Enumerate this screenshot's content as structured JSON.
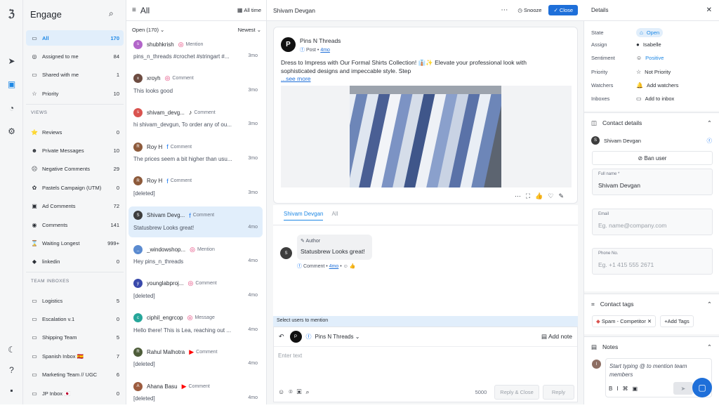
{
  "app": {
    "title": "Engage"
  },
  "sidebar": {
    "items": [
      {
        "icon": "inbox-icon",
        "glyph": "▭",
        "label": "All",
        "count": "170",
        "selected": true
      },
      {
        "icon": "user-icon",
        "glyph": "◎",
        "label": "Assigned to me",
        "count": "84"
      },
      {
        "icon": "share-icon",
        "glyph": "▭",
        "label": "Shared with me",
        "count": "1"
      },
      {
        "icon": "star-icon",
        "glyph": "☆",
        "label": "Priority",
        "count": "10"
      }
    ],
    "views_heading": "VIEWS",
    "views": [
      {
        "icon": "star-emoji-icon",
        "glyph": "⭐",
        "label": "Reviews",
        "count": "0"
      },
      {
        "icon": "face-emoji-icon",
        "glyph": "☻",
        "label": "Private Messages",
        "count": "10"
      },
      {
        "icon": "angry-emoji-icon",
        "glyph": "☹",
        "label": "Negative Comments",
        "count": "29"
      },
      {
        "icon": "leaf-emoji-icon",
        "glyph": "✿",
        "label": "Pastels Campaign (UTM)",
        "count": "0"
      },
      {
        "icon": "ad-emoji-icon",
        "glyph": "▣",
        "label": "Ad Comments",
        "count": "72"
      },
      {
        "icon": "target-emoji-icon",
        "glyph": "◉",
        "label": "Comments",
        "count": "141"
      },
      {
        "icon": "hourglass-icon",
        "glyph": "⌛",
        "label": "Waiting Longest",
        "count": "999+"
      },
      {
        "icon": "bag-emoji-icon",
        "glyph": "◆",
        "label": "linkedin",
        "count": "0"
      }
    ],
    "team_heading": "TEAM INBOXES",
    "teams": [
      {
        "label": "Logistics",
        "count": "5"
      },
      {
        "label": "Escalation v.1",
        "count": "0"
      },
      {
        "label": "Shipping Team",
        "count": "5"
      },
      {
        "label": "Spanish Inbox 🇪🇸",
        "count": "7"
      },
      {
        "label": "Marketing Team // UGC",
        "count": "6"
      },
      {
        "label": "JP Inbox 🇯🇵",
        "count": "0"
      }
    ]
  },
  "list": {
    "title": "All",
    "time_filter": "All time",
    "status_filter": "Open (170)",
    "sort": "Newest",
    "conversations": [
      {
        "name": "shubhkrish",
        "channel": "instagram",
        "chglyph": "◎",
        "chcolor": "#e1306c",
        "type": "Mention",
        "text": "pins_n_threads #crochet #stringart #...",
        "time": "3mo",
        "avc": "#b265c9",
        "ini": "s"
      },
      {
        "name": "xroyh",
        "channel": "instagram",
        "chglyph": "◎",
        "chcolor": "#e1306c",
        "type": "Comment",
        "text": "This looks good",
        "time": "3mo",
        "avc": "#6d4c41",
        "ini": "x"
      },
      {
        "name": "shivam_devg...",
        "channel": "tiktok",
        "chglyph": "♪",
        "chcolor": "#111111",
        "type": "Comment",
        "text": "hi shivam_devgun, To order any of ou...",
        "time": "3mo",
        "avc": "#d9534f",
        "ini": "s"
      },
      {
        "name": "Roy H",
        "channel": "facebook",
        "chglyph": "f",
        "chcolor": "#1877f2",
        "type": "Comment",
        "text": "The prices seem a bit higher than usu...",
        "time": "3mo",
        "avc": "#8d5a3b",
        "ini": "R"
      },
      {
        "name": "Roy H",
        "channel": "facebook",
        "chglyph": "f",
        "chcolor": "#1877f2",
        "type": "Comment",
        "text": "[deleted]",
        "time": "3mo",
        "avc": "#8d5a3b",
        "ini": "R"
      },
      {
        "name": "Shivam Devg...",
        "channel": "facebook",
        "chglyph": "f",
        "chcolor": "#1877f2",
        "type": "Comment",
        "text": "Statusbrew Looks great!",
        "time": "4mo",
        "avc": "#3d3d3d",
        "ini": "S",
        "selected": true
      },
      {
        "name": "_windowshop...",
        "channel": "instagram",
        "chglyph": "◎",
        "chcolor": "#e1306c",
        "type": "Mention",
        "text": "Hey pins_n_threads",
        "time": "4mo",
        "avc": "#5b8bd0",
        "ini": "_"
      },
      {
        "name": "younglabproj...",
        "channel": "instagram",
        "chglyph": "◎",
        "chcolor": "#e1306c",
        "type": "Comment",
        "text": "[deleted]",
        "time": "4mo",
        "avc": "#3949ab",
        "ini": "y"
      },
      {
        "name": "ciphil_engrcop",
        "channel": "instagram",
        "chglyph": "◎",
        "chcolor": "#e1306c",
        "type": "Message",
        "text": "Hello there! This is Lea, reaching out ...",
        "time": "4mo",
        "avc": "#26a69a",
        "ini": "c"
      },
      {
        "name": "Rahul Malhotra",
        "channel": "youtube",
        "chglyph": "▶",
        "chcolor": "#ff0000",
        "type": "Comment",
        "text": "[deleted]",
        "time": "4mo",
        "avc": "#4e5d3a",
        "ini": "R"
      },
      {
        "name": "Ahana Basu",
        "channel": "youtube",
        "chglyph": "▶",
        "chcolor": "#ff0000",
        "type": "Comment",
        "text": "[deleted]",
        "time": "4mo",
        "avc": "#9c5b3e",
        "ini": "A"
      }
    ]
  },
  "main": {
    "contact_name": "Shivam Devgan",
    "snooze_label": "Snooze",
    "close_label": "Close",
    "post": {
      "brand": "Pins N Threads",
      "kind": "Post",
      "age": "4mo",
      "text": "Dress to Impress with Our Formal Shirts Collection! 👔✨ Elevate your professional look with sophisticated designs and impeccable style. Step",
      "see_more": "...see more"
    },
    "tabs": [
      "Shivam Devgan",
      "All"
    ],
    "reply": {
      "author_label": "Author",
      "text": "Statusbrew Looks great!",
      "kind": "Comment",
      "age": "4mo"
    },
    "mention_bar": "Select users to mention",
    "compose": {
      "account": "Pins N Threads",
      "add_note": "Add note",
      "placeholder": "Enter text",
      "char_count": "5000",
      "reply_close": "Reply & Close",
      "reply": "Reply"
    }
  },
  "details": {
    "title": "Details",
    "rows": [
      {
        "key": "State",
        "value": "Open",
        "icon": "inbox-icon",
        "glyph": "⌂",
        "chip": true
      },
      {
        "key": "Assign",
        "value": "Isabelle",
        "icon": "avatar",
        "glyph": "●"
      },
      {
        "key": "Sentiment",
        "value": "Positive",
        "icon": "smile-icon",
        "glyph": "☺",
        "color": "#1e88e5"
      },
      {
        "key": "Priority",
        "value": "Not Priority",
        "icon": "star-icon",
        "glyph": "☆"
      },
      {
        "key": "Watchers",
        "value": "Add watchers",
        "icon": "bell-icon",
        "glyph": "🔔"
      },
      {
        "key": "Inboxes",
        "value": "Add to inbox",
        "icon": "inbox-icon",
        "glyph": "▭"
      }
    ],
    "contact": {
      "heading": "Contact details",
      "name": "Shivam Devgan",
      "ban": "Ban user",
      "full_name_label": "Full name *",
      "full_name": "Shivam Devgan",
      "email_label": "Email",
      "email_placeholder": "Eg. name@company.com",
      "phone_label": "Phone No.",
      "phone_placeholder": "Eg. +1 415 555 2671"
    },
    "tags": {
      "heading": "Contact tags",
      "tag": "Spam - Competitor",
      "add": "+Add Tags"
    },
    "notes": {
      "heading": "Notes",
      "placeholder": "Start typing @ to mention team members"
    }
  }
}
